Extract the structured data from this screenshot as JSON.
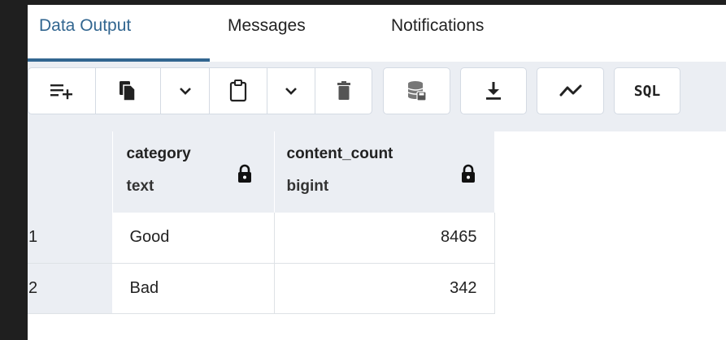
{
  "tabs": [
    {
      "label": "Data Output",
      "active": true
    },
    {
      "label": "Messages",
      "active": false
    },
    {
      "label": "Notifications",
      "active": false
    }
  ],
  "toolbar": {
    "sql_label": "SQL",
    "icons": [
      "add-row-icon",
      "copy-icon",
      "chevron-down-icon",
      "paste-icon",
      "chevron-down-icon",
      "delete-icon",
      "save-data-icon",
      "download-icon",
      "graph-icon",
      "sql-icon"
    ]
  },
  "grid": {
    "columns": [
      {
        "name": "category",
        "type": "text"
      },
      {
        "name": "content_count",
        "type": "bigint"
      }
    ],
    "rows": [
      {
        "num": "1",
        "category": "Good",
        "content_count": "8465"
      },
      {
        "num": "2",
        "category": "Bad",
        "content_count": "342"
      }
    ]
  },
  "colors": {
    "accent": "#326690",
    "toolbar_bg": "#ebeef3",
    "window_bg": "#1f1f1f"
  }
}
